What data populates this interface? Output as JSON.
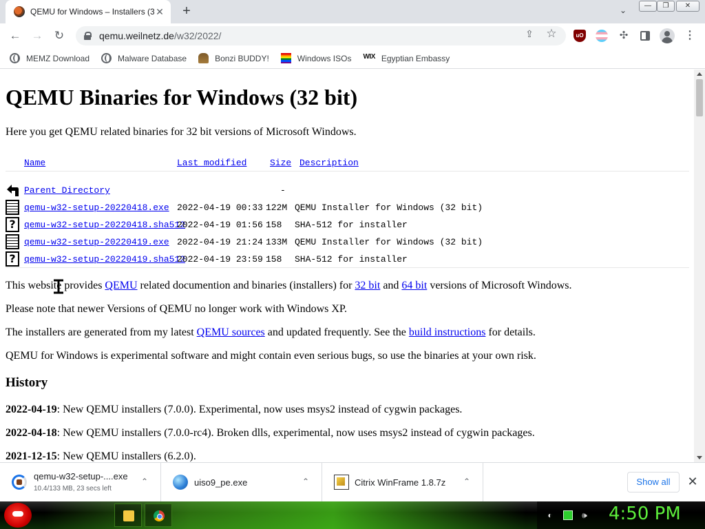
{
  "browser": {
    "tab_title": "QEMU for Windows – Installers (3",
    "tab_close": "✕",
    "new_tab": "+",
    "tab_search": "⌄",
    "window": {
      "minimize": "—",
      "restore": "❐",
      "close": "✕"
    },
    "nav": {
      "back": "←",
      "forward": "→",
      "reload": "↻"
    },
    "url_host": "qemu.weilnetz.de",
    "url_path": "/w32/2022/",
    "omni_share": "⇪",
    "omni_star": "☆",
    "ext_ublock": "uO",
    "ext_puzzle": "✣",
    "menu": "⋮",
    "bookmarks": [
      {
        "label": "MEMZ Download",
        "icon": "globe-icon"
      },
      {
        "label": "Malware Database",
        "icon": "globe-icon"
      },
      {
        "label": "Bonzi BUDDY!",
        "icon": "bonzi-icon"
      },
      {
        "label": "Windows ISOs",
        "icon": "rainbow-flag-icon"
      },
      {
        "label": "Egyptian Embassy",
        "icon": "wix-icon"
      }
    ],
    "wix_text": "WIX"
  },
  "page": {
    "title": "QEMU Binaries for Windows (32 bit)",
    "intro": "Here you get QEMU related binaries for 32 bit versions of Microsoft Windows.",
    "listing": {
      "headers": {
        "name": "Name",
        "modified": "Last modified",
        "size": "Size",
        "description": "Description"
      },
      "parent": {
        "name": "Parent Directory",
        "size": "-"
      },
      "rows": [
        {
          "icon": "binary-file-icon",
          "name": "qemu-w32-setup-20220418.exe",
          "modified": "2022-04-19 00:33",
          "size": "122M",
          "description": "QEMU Installer for Windows (32 bit)"
        },
        {
          "icon": "unknown-file-icon",
          "name": "qemu-w32-setup-20220418.sha512",
          "modified": "2022-04-19 01:56",
          "size": "158",
          "description": "SHA-512 for installer"
        },
        {
          "icon": "binary-file-icon",
          "name": "qemu-w32-setup-20220419.exe",
          "modified": "2022-04-19 21:24",
          "size": "133M",
          "description": "QEMU Installer for Windows (32 bit)"
        },
        {
          "icon": "unknown-file-icon",
          "name": "qemu-w32-setup-20220419.sha512",
          "modified": "2022-04-19 23:59",
          "size": "158",
          "description": "SHA-512 for installer"
        }
      ]
    },
    "para1": {
      "t1": "This website provides ",
      "l1": "QEMU",
      "t2": " related documention and binaries (installers) for ",
      "l2": "32 bit",
      "t3": " and ",
      "l3": "64 bit",
      "t4": " versions of Microsoft Windows."
    },
    "para2": "Please note that newer Versions of QEMU no longer work with Windows XP.",
    "para3": {
      "t1": "The installers are generated from my latest ",
      "l1": "QEMU sources",
      "t2": " and updated frequently. See the ",
      "l2": "build instructions",
      "t3": " for details."
    },
    "para4": "QEMU for Windows is experimental software and might contain even serious bugs, so use the binaries at your own risk.",
    "history_heading": "History",
    "history": [
      {
        "date": "2022-04-19",
        "text": ": New QEMU installers (7.0.0). Experimental, now uses msys2 instead of cygwin packages."
      },
      {
        "date": "2022-04-18",
        "text": ": New QEMU installers (7.0.0-rc4). Broken dlls, experimental, now uses msys2 instead of cygwin packages."
      },
      {
        "date": "2021-12-15",
        "text": ": New QEMU installers (6.2.0)."
      }
    ]
  },
  "downloads": {
    "items": [
      {
        "name": "qemu-w32-setup-....exe",
        "status": "10.4/133 MB, 23 secs left",
        "progress_fraction": 0.078
      },
      {
        "name": "uiso9_pe.exe",
        "status": ""
      },
      {
        "name": "Citrix WinFrame 1.8.7z",
        "status": ""
      }
    ],
    "caret": "⌃",
    "show_all": "Show all",
    "close": "✕"
  },
  "taskbar": {
    "clock": "4:50 PM",
    "tray_sound": "🕪",
    "tray_misc": "◐"
  }
}
